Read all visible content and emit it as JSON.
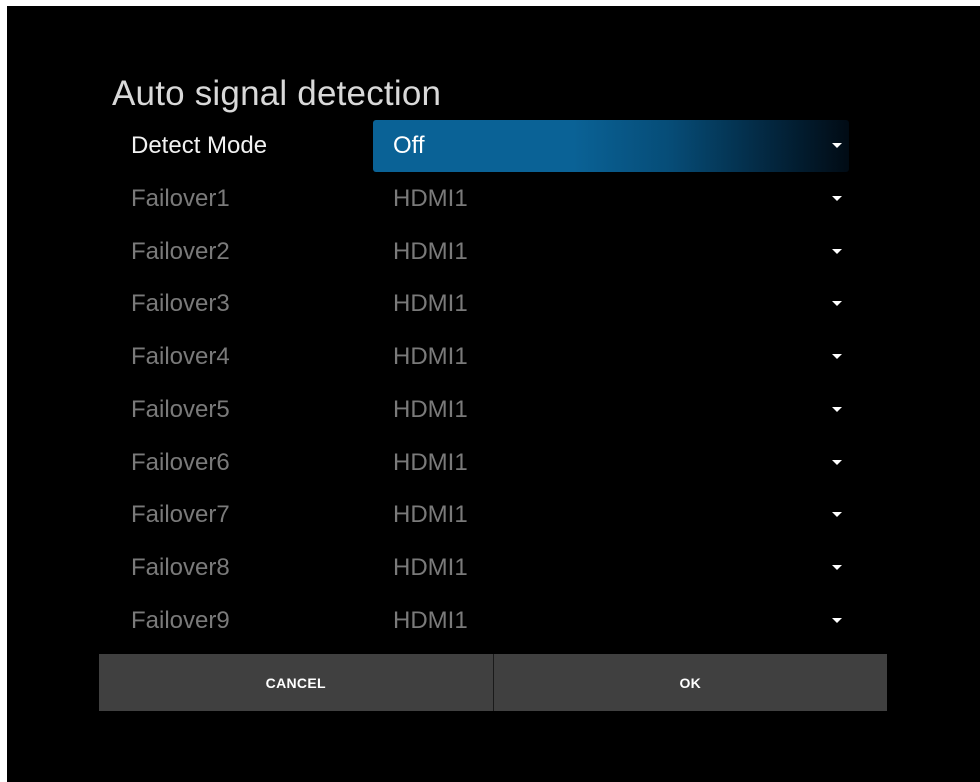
{
  "dialog": {
    "title": "Auto signal detection"
  },
  "rows": [
    {
      "label": "Detect Mode",
      "value": "Off"
    },
    {
      "label": "Failover1",
      "value": "HDMI1"
    },
    {
      "label": "Failover2",
      "value": "HDMI1"
    },
    {
      "label": "Failover3",
      "value": "HDMI1"
    },
    {
      "label": "Failover4",
      "value": "HDMI1"
    },
    {
      "label": "Failover5",
      "value": "HDMI1"
    },
    {
      "label": "Failover6",
      "value": "HDMI1"
    },
    {
      "label": "Failover7",
      "value": "HDMI1"
    },
    {
      "label": "Failover8",
      "value": "HDMI1"
    },
    {
      "label": "Failover9",
      "value": "HDMI1"
    }
  ],
  "buttons": {
    "cancel_label": "CANCEL",
    "ok_label": "OK"
  },
  "colors": {
    "background": "#000000",
    "highlight": "#0a6296",
    "button": "#404040",
    "active_text": "#f2f2f2",
    "inactive_text": "#7a7a7a"
  },
  "icons": {
    "dropdown": "chevron-down-icon"
  }
}
